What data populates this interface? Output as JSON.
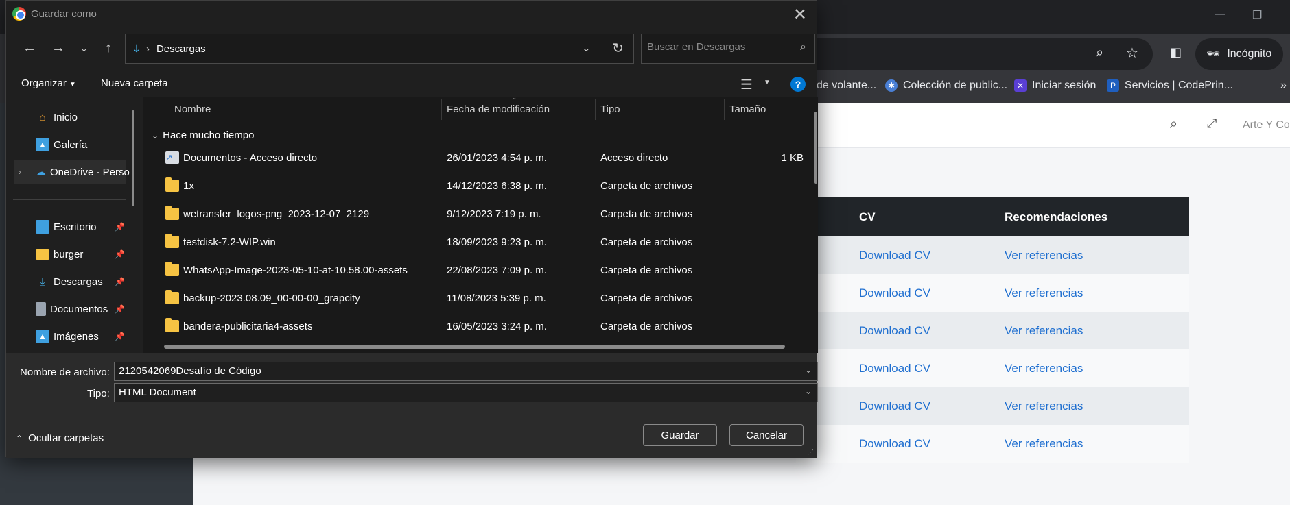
{
  "browser": {
    "omnibox_icons": [
      "zoom-icon",
      "star-icon"
    ],
    "incognito_label": "Incógnito",
    "bookmarks": [
      {
        "label": "de volante...",
        "color": "#35363a"
      },
      {
        "label": "Colección de public...",
        "color": "#4a7fd4"
      },
      {
        "label": "Iniciar sesión",
        "color": "#5a3fd4"
      },
      {
        "label": "Servicios | CodePrin...",
        "color": "#1f5fbf"
      }
    ],
    "more_bookmarks": "»",
    "header_text": "Arte Y Co",
    "table": {
      "headers": [
        "CV",
        "Recomendaciones"
      ],
      "rows": [
        {
          "cv": "Download CV",
          "ref": "Ver referencias"
        },
        {
          "cv": "Download CV",
          "ref": "Ver referencias"
        },
        {
          "cv": "Download CV",
          "ref": "Ver referencias"
        },
        {
          "cv": "Download CV",
          "ref": "Ver referencias"
        },
        {
          "cv": "Download CV",
          "ref": "Ver referencias"
        },
        {
          "cv": "Download CV",
          "ref": "Ver referencias"
        }
      ]
    }
  },
  "dialog": {
    "title": "Guardar como",
    "address": {
      "separator": "›",
      "location": "Descargas"
    },
    "search_placeholder": "Buscar en Descargas",
    "commands": {
      "organize": "Organizar",
      "new_folder": "Nueva carpeta",
      "help": "?"
    },
    "nav_items": [
      {
        "label": "Inicio",
        "icon": "home-icon",
        "pinned": false
      },
      {
        "label": "Galería",
        "icon": "gallery-icon",
        "pinned": false
      },
      {
        "label": "OneDrive - Perso",
        "icon": "onedrive-icon",
        "pinned": false,
        "expandable": true
      },
      {
        "label": "Escritorio",
        "icon": "desktop-icon",
        "pinned": true
      },
      {
        "label": "burger",
        "icon": "folder-icon",
        "pinned": true
      },
      {
        "label": "Descargas",
        "icon": "download-icon",
        "pinned": true
      },
      {
        "label": "Documentos",
        "icon": "documents-icon",
        "pinned": true
      },
      {
        "label": "Imágenes",
        "icon": "pictures-icon",
        "pinned": true
      }
    ],
    "columns": [
      "Nombre",
      "Fecha de modificación",
      "Tipo",
      "Tamaño"
    ],
    "group_label": "Hace mucho tiempo",
    "files": [
      {
        "name": "Documentos - Acceso directo",
        "date": "26/01/2023 4:54 p. m.",
        "type": "Acceso directo",
        "size": "1 KB",
        "kind": "shortcut"
      },
      {
        "name": "1x",
        "date": "14/12/2023 6:38 p. m.",
        "type": "Carpeta de archivos",
        "size": "",
        "kind": "folder"
      },
      {
        "name": "wetransfer_logos-png_2023-12-07_2129",
        "date": "9/12/2023 7:19 p. m.",
        "type": "Carpeta de archivos",
        "size": "",
        "kind": "folder"
      },
      {
        "name": "testdisk-7.2-WIP.win",
        "date": "18/09/2023 9:23 p. m.",
        "type": "Carpeta de archivos",
        "size": "",
        "kind": "folder"
      },
      {
        "name": "WhatsApp-Image-2023-05-10-at-10.58.00-assets",
        "date": "22/08/2023 7:09 p. m.",
        "type": "Carpeta de archivos",
        "size": "",
        "kind": "folder"
      },
      {
        "name": "backup-2023.08.09_00-00-00_grapcity",
        "date": "11/08/2023 5:39 p. m.",
        "type": "Carpeta de archivos",
        "size": "",
        "kind": "folder"
      },
      {
        "name": "bandera-publicitaria4-assets",
        "date": "16/05/2023 3:24 p. m.",
        "type": "Carpeta de archivos",
        "size": "",
        "kind": "folder"
      }
    ],
    "filename_label": "Nombre de archivo:",
    "filename_value": "2120542069Desafío de Código",
    "type_label": "Tipo:",
    "type_value": "HTML Document",
    "hide_folders_label": "Ocultar carpetas",
    "save_label": "Guardar",
    "cancel_label": "Cancelar"
  }
}
